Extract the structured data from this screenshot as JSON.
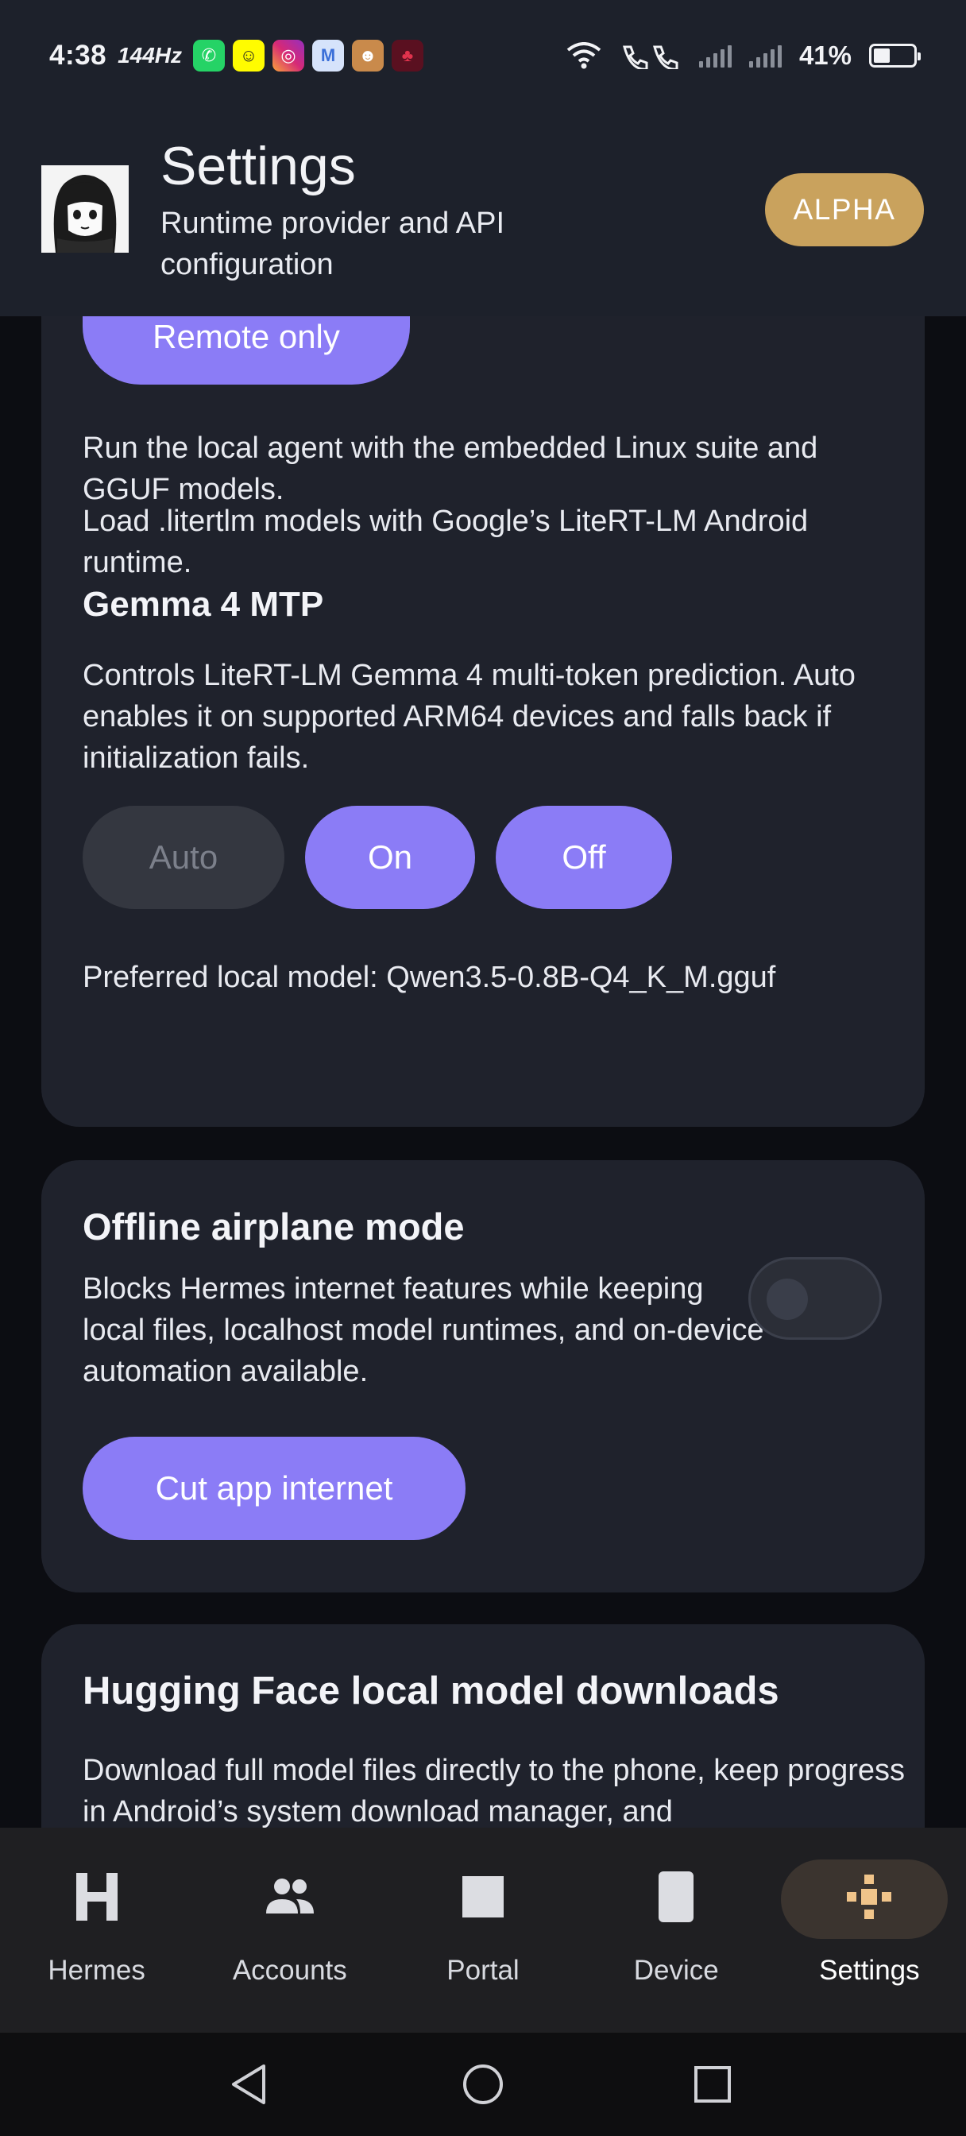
{
  "status_bar": {
    "time": "4:38",
    "refresh_rate": "144Hz",
    "battery": "41%",
    "battery_level": 0.41,
    "notification_icons": [
      "whatsapp-icon",
      "snapchat-icon",
      "instagram-icon",
      "gmail-icon",
      "game-icon",
      "app-icon"
    ]
  },
  "header": {
    "title": "Settings",
    "subtitle": "Runtime provider and API configuration",
    "badge": "ALPHA"
  },
  "runtime_card": {
    "remote_only_label": "Remote only",
    "linux_desc": "Run the local agent with the embedded Linux suite and GGUF models.",
    "litert_desc": "Load .litertlm models with Google’s LiteRT-LM Android runtime.",
    "mtp_heading": "Gemma 4 MTP",
    "mtp_desc": "Controls LiteRT-LM Gemma 4 multi-token prediction. Auto enables it on supported ARM64 devices and falls back if initialization fails.",
    "mtp_options": [
      "Auto",
      "On",
      "Off"
    ],
    "preferred_model": "Preferred local model: Qwen3.5-0.8B-Q4_K_M.gguf"
  },
  "airplane_card": {
    "heading": "Offline airplane mode",
    "desc": "Blocks Hermes internet features while keeping local files, localhost model runtimes, and on-device automation available.",
    "toggle_on": false,
    "button_label": "Cut app internet"
  },
  "hf_card": {
    "heading": "Hugging Face local model downloads",
    "desc": "Download full model files directly to the phone, keep progress in Android’s system download manager, and"
  },
  "bottom_nav": {
    "items": [
      {
        "label": "Hermes",
        "icon": "hermes-h-icon"
      },
      {
        "label": "Accounts",
        "icon": "people-icon"
      },
      {
        "label": "Portal",
        "icon": "square-icon"
      },
      {
        "label": "Device",
        "icon": "phone-icon"
      },
      {
        "label": "Settings",
        "icon": "settings-cross-icon"
      }
    ],
    "active": "Settings"
  },
  "colors": {
    "accent": "#8b7cf6",
    "badge": "#c9a25d",
    "card": "#1f222c",
    "header": "#1d212b"
  }
}
